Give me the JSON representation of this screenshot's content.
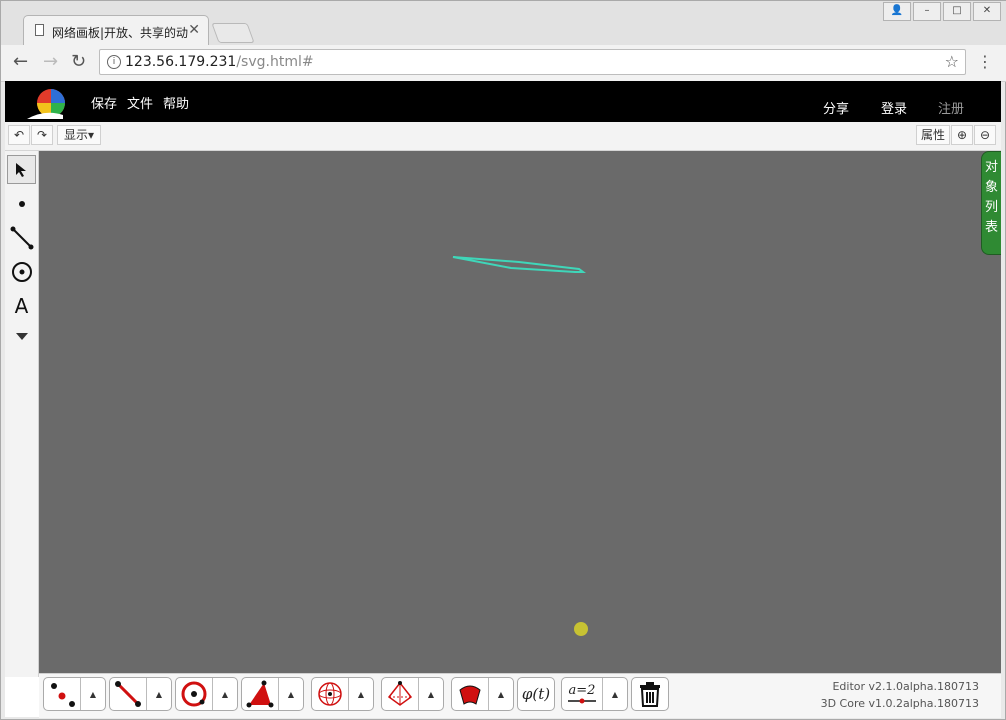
{
  "browser": {
    "tab_title": "网络画板|开放、共享的动",
    "tab_close": "✕",
    "url_host": "123.56.179.231",
    "url_path": "/svg.html#",
    "back": "←",
    "forward": "→",
    "reload": "↻",
    "star": "☆",
    "menu": "⋮",
    "info": "i",
    "win_buttons": [
      "👤",
      "–",
      "□",
      "✕"
    ]
  },
  "app": {
    "menu": [
      "保存",
      "文件",
      "帮助"
    ],
    "share": "分享",
    "login": "登录",
    "register": "注册",
    "undo": "↶",
    "redo": "↷",
    "display": "显示▾",
    "properties": "属性",
    "zoom_in": "⊕",
    "zoom_out": "⊖",
    "object_list": "对象列表",
    "text_tool": "A",
    "param_label": "a=2",
    "function_label": "φ(t)",
    "editor_version": "Editor v2.1.0alpha.180713",
    "core_version": "3D Core v1.0.2alpha.180713",
    "colors": {
      "topbar": "#000000",
      "canvas": "#6a6a6a",
      "shape_stroke": "#3fd6b9",
      "point": "#c7c233",
      "object_list_bg": "#2f8a33",
      "tool_red": "#d01010"
    }
  }
}
